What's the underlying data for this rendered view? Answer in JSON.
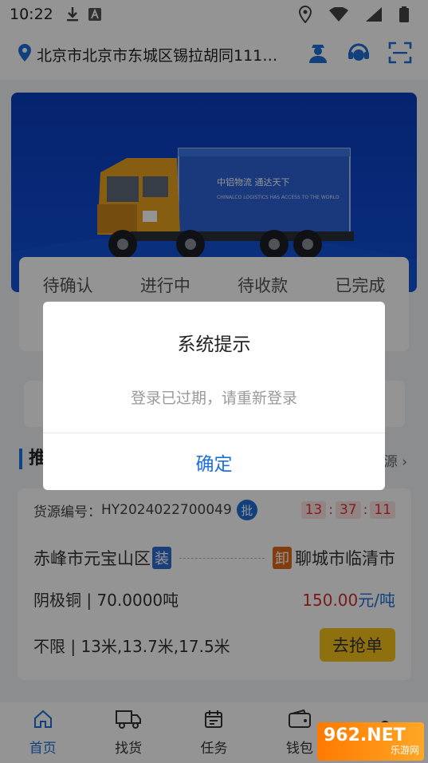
{
  "status_bar": {
    "time": "10:22",
    "icons": [
      "download-icon",
      "a-notification-icon",
      "location-icon",
      "wifi-icon",
      "signal-icon",
      "battery-icon"
    ]
  },
  "header": {
    "location": "北京市北京市东城区锡拉胡同111…",
    "icons": [
      "driver-icon",
      "customer-service-icon",
      "scan-icon"
    ]
  },
  "banner": {
    "truck_logo_text": "中铝物流 通达天下",
    "truck_sub_text": "CHINALCO LOGISTICS HAS ACCESS TO THE WORLD"
  },
  "order_tabs": [
    "待确认",
    "进行中",
    "待收款",
    "已完成"
  ],
  "section": {
    "title": "推",
    "more": "源"
  },
  "cargo": {
    "id_label": "货源编号：",
    "id_value": "HY2024022700049",
    "badge": "批",
    "countdown": [
      "13",
      "37",
      "11"
    ],
    "origin": "赤峰市元宝山区",
    "load_tag": "装",
    "unload_tag": "卸",
    "destination": "聊城市临清市",
    "goods": "阴极铜 | 70.0000吨",
    "price": "150.00",
    "price_unit": "元/吨",
    "requirement": "不限 | 13米,13.7米,17.5米",
    "grab_button": "去抢单"
  },
  "bottom_nav": [
    {
      "label": "首页",
      "icon": "home-icon",
      "active": true
    },
    {
      "label": "找货",
      "icon": "truck-icon",
      "active": false
    },
    {
      "label": "任务",
      "icon": "calendar-icon",
      "active": false
    },
    {
      "label": "钱包",
      "icon": "wallet-icon",
      "active": false
    }
  ],
  "dialog": {
    "title": "系统提示",
    "message": "登录已过期，请重新登录",
    "confirm": "确定"
  },
  "watermark": {
    "big": "962.NET",
    "small": "乐游网"
  },
  "colors": {
    "accent": "#1e6fd8",
    "banner": "#0e49cf",
    "price": "#d32f2f",
    "grab": "#f4c21a"
  }
}
